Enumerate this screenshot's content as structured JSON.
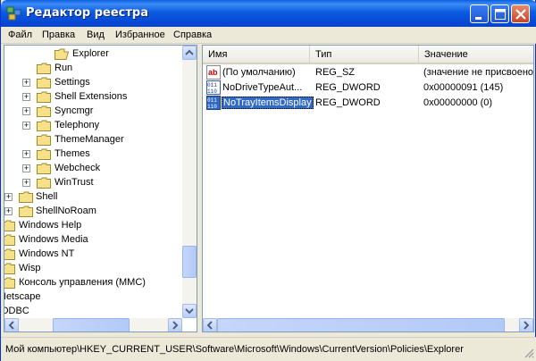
{
  "window": {
    "title": "Редактор реестра",
    "accent_color": "#0a5fe0"
  },
  "menu": [
    {
      "label": "Файл"
    },
    {
      "label": "Правка"
    },
    {
      "label": "Вид"
    },
    {
      "label": "Избранное"
    },
    {
      "label": "Справка"
    }
  ],
  "tree": {
    "items": [
      {
        "label": "Explorer",
        "expander": ""
      },
      {
        "label": "Run",
        "expander": ""
      },
      {
        "label": "Settings",
        "expander": "+"
      },
      {
        "label": "Shell Extensions",
        "expander": "+"
      },
      {
        "label": "Syncmgr",
        "expander": "+"
      },
      {
        "label": "Telephony",
        "expander": "+"
      },
      {
        "label": "ThemeManager",
        "expander": ""
      },
      {
        "label": "Themes",
        "expander": "+"
      },
      {
        "label": "Webcheck",
        "expander": "+"
      },
      {
        "label": "WinTrust",
        "expander": "+"
      },
      {
        "label": "Shell",
        "expander": "+"
      },
      {
        "label": "ShellNoRoam",
        "expander": "+"
      },
      {
        "label": "Windows Help",
        "expander": ""
      },
      {
        "label": "Windows Media",
        "expander": ""
      },
      {
        "label": "Windows NT",
        "expander": ""
      },
      {
        "label": "Wisp",
        "expander": ""
      },
      {
        "label": "Консоль управления (MMC)",
        "expander": ""
      },
      {
        "label": "Netscape",
        "expander": ""
      },
      {
        "label": "ODBC",
        "expander": ""
      }
    ]
  },
  "list": {
    "columns": [
      {
        "label": "Имя"
      },
      {
        "label": "Тип"
      },
      {
        "label": "Значение"
      }
    ],
    "rows": [
      {
        "name": "(По умолчанию)",
        "type": "REG_SZ",
        "value": "(значение не присвоено)",
        "icon": "string-value-icon"
      },
      {
        "name": "NoDriveTypeAut...",
        "type": "REG_DWORD",
        "value": "0x00000091 (145)",
        "icon": "binary-value-icon"
      },
      {
        "name": "NoTrayItemsDisplay",
        "type": "REG_DWORD",
        "value": "0x00000000 (0)",
        "icon": "binary-value-icon"
      }
    ]
  },
  "status": {
    "path": "Мой компьютер\\HKEY_CURRENT_USER\\Software\\Microsoft\\Windows\\CurrentVersion\\Policies\\Explorer"
  }
}
